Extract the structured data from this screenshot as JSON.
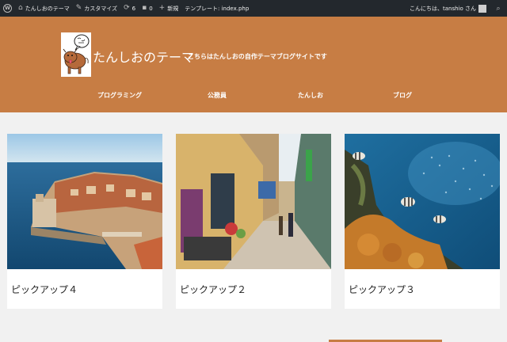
{
  "admin_bar": {
    "site_name": "たんしおのテーマ",
    "customize": "カスタマイズ",
    "updates_count": "6",
    "comments_count": "0",
    "new_label": "新規",
    "template_info": "テンプレート: index.php",
    "greeting": "こんにちは、tanshio さん",
    "icons": [
      "wordpress-icon",
      "home-icon",
      "brush-icon",
      "update-icon",
      "comment-icon",
      "plus-icon",
      "avatar",
      "search-icon"
    ]
  },
  "header": {
    "title": "たんしおのテーマ",
    "description": "こちらはたんしおの自作テーマブログサイトです",
    "logo_alt": "cow mascot logo",
    "background_color": "#c77d44"
  },
  "nav": {
    "items": [
      {
        "label": "プログラミング"
      },
      {
        "label": "公務員"
      },
      {
        "label": "たんしお"
      },
      {
        "label": "ブログ"
      }
    ]
  },
  "pickups": [
    {
      "title": "ピックアップ４",
      "image": "coastal-town-photo"
    },
    {
      "title": "ピックアップ２",
      "image": "street-cafe-photo"
    },
    {
      "title": "ピックアップ３",
      "image": "coral-reef-fish-photo"
    }
  ]
}
